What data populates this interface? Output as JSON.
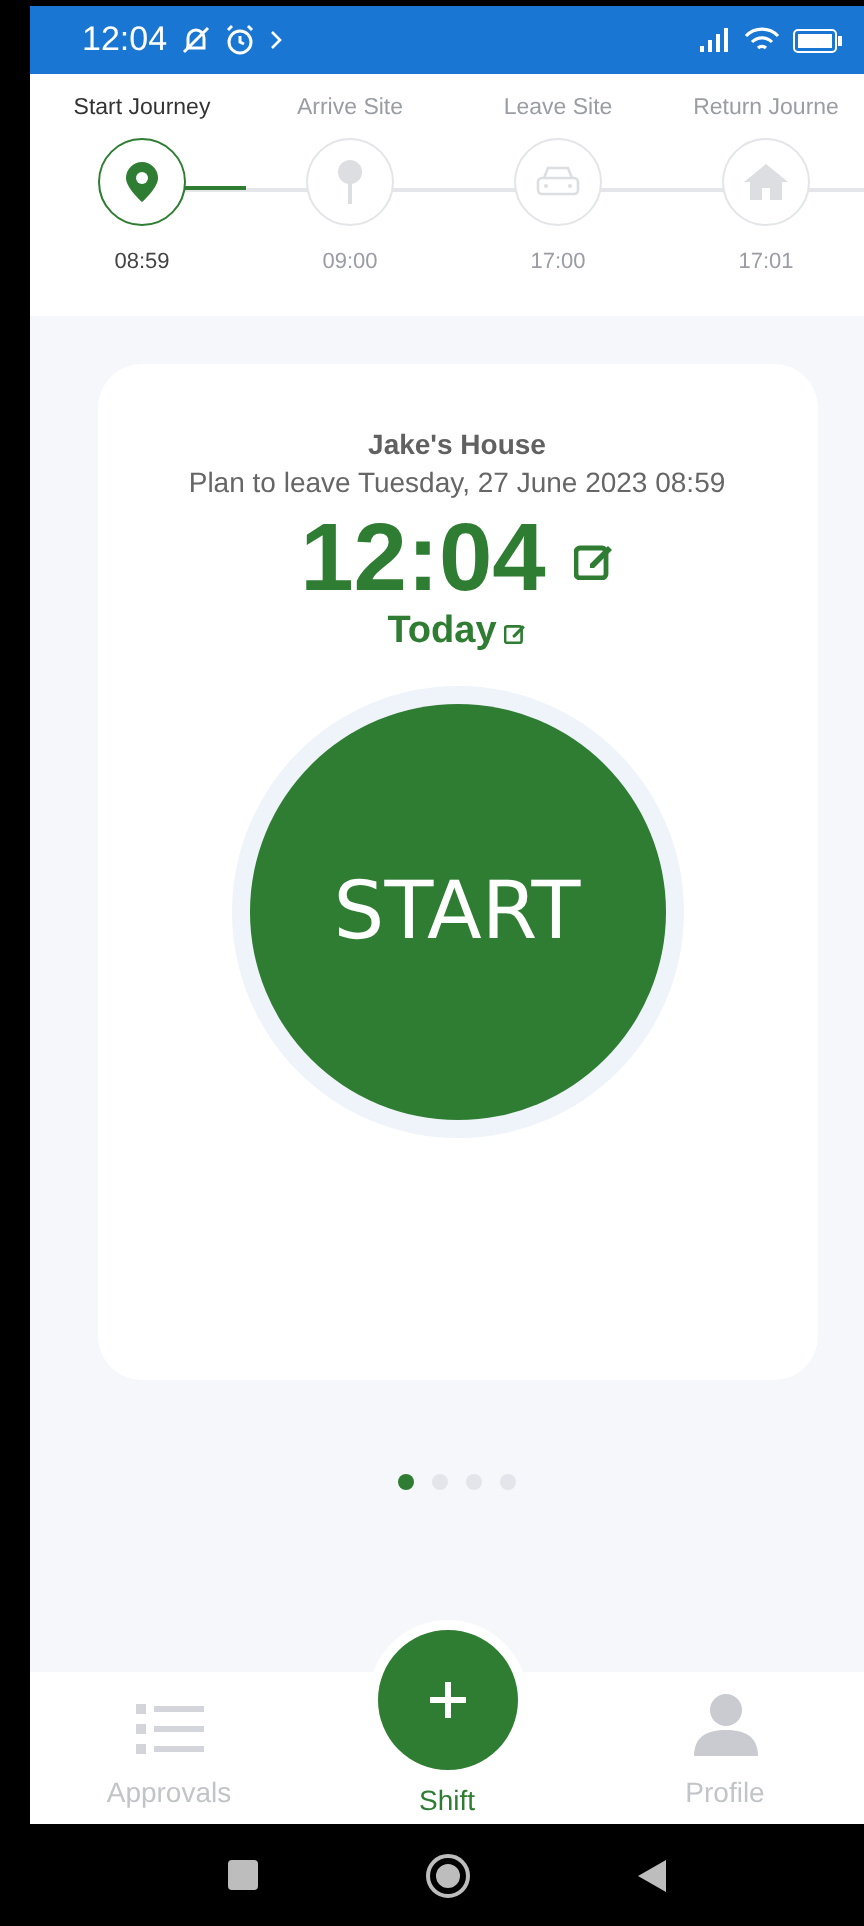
{
  "status_bar": {
    "time": "12:04"
  },
  "steps": [
    {
      "label": "Start Journey",
      "kind": "pin",
      "time": "08:59",
      "selected": true
    },
    {
      "label": "Arrive Site",
      "kind": "marker",
      "time": "09:00",
      "selected": false
    },
    {
      "label": "Leave Site",
      "kind": "car",
      "time": "17:00",
      "selected": false
    },
    {
      "label": "Return Journe",
      "kind": "home",
      "time": "17:01",
      "selected": false
    }
  ],
  "card": {
    "place": "Jake's House",
    "plan": "Plan to leave Tuesday, 27 June 2023 08:59",
    "time": "12:04",
    "day": "Today",
    "button": "START"
  },
  "pager": [
    {
      "selected": true
    },
    {
      "selected": false
    },
    {
      "selected": false
    },
    {
      "selected": false
    }
  ],
  "bottom_nav": [
    {
      "label": "Approvals",
      "kind": "list",
      "selected": false
    },
    {
      "label": "Shift",
      "kind": "fab",
      "selected": true
    },
    {
      "label": "Profile",
      "kind": "person",
      "selected": false
    }
  ]
}
